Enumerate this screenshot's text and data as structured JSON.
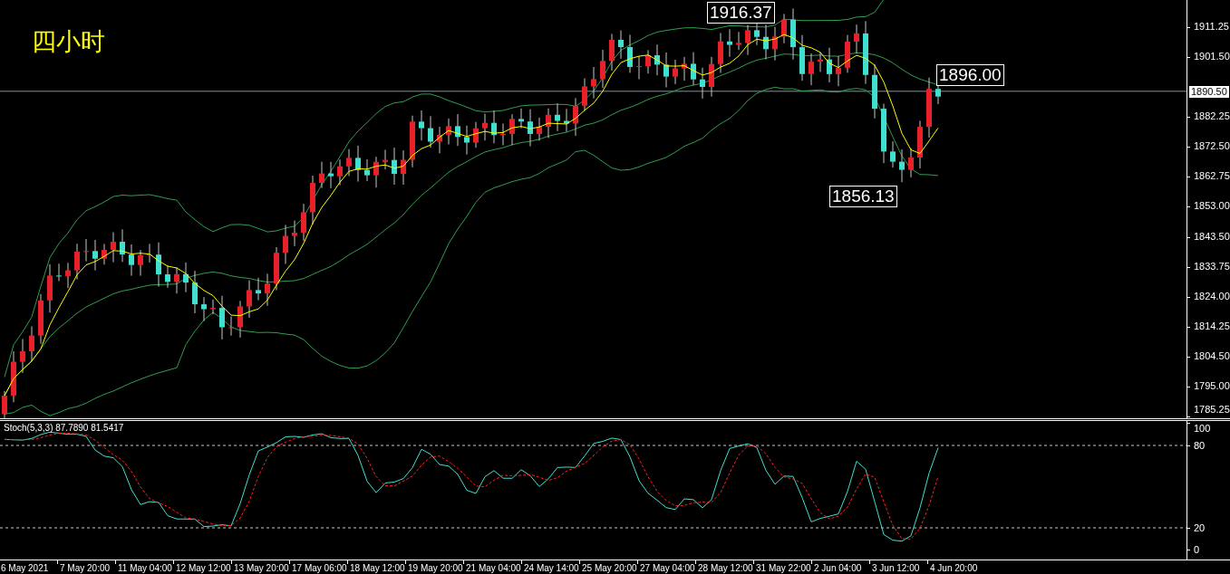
{
  "chart": {
    "timeframe_label": "四小时",
    "price_axis": [
      "1911.25",
      "1901.50",
      "1882.25",
      "1872.50",
      "1862.75",
      "1853.00",
      "1843.50",
      "1833.75",
      "1824.00",
      "1814.25",
      "1804.50",
      "1795.00",
      "1785.25"
    ],
    "current_price": "1890.50",
    "price_callouts": [
      "1916.37",
      "1896.00",
      "1856.13"
    ]
  },
  "indicator": {
    "title": "Stoch(5,3,3) 87.7890 81.5417",
    "axis": [
      "100",
      "80",
      "20",
      "0"
    ]
  },
  "time_axis": [
    "6 May 2021",
    "7 May 20:00",
    "11 May 04:00",
    "12 May 12:00",
    "13 May 20:00",
    "17 May 06:00",
    "18 May 12:00",
    "19 May 20:00",
    "21 May 04:00",
    "24 May 14:00",
    "25 May 20:00",
    "27 May 04:00",
    "28 May 12:00",
    "31 May 22:00",
    "2 Jun 04:00",
    "3 Jun 12:00",
    "4 Jun 20:00"
  ]
}
